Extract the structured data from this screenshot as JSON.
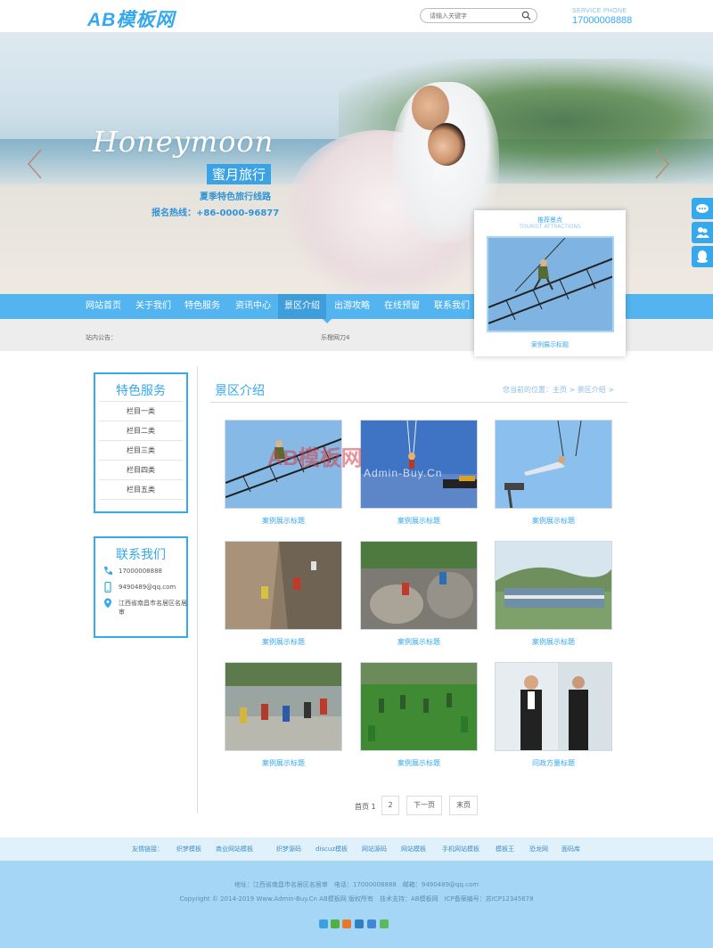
{
  "header": {
    "logo": "AB模板网",
    "search_placeholder": "请输入关键字",
    "phone_label": "SERVICE PHONE",
    "phone": "17000008888"
  },
  "banner": {
    "script": "Honeymoon",
    "title": "蜜月旅行",
    "subtitle": "夏季特色旅行线路",
    "hotline": "报名热线：+86-0000-96877"
  },
  "nav": {
    "items": [
      "网站首页",
      "关于我们",
      "特色服务",
      "资讯中心",
      "景区介绍",
      "出游攻略",
      "在线预留",
      "联系我们"
    ]
  },
  "notice": {
    "label": "站内公告：",
    "text": "乐橙网刀4"
  },
  "featured": {
    "title": "推荐景点",
    "subtitle": "TOURIST ATTRACTIONS",
    "caption": "案例展示标题"
  },
  "sidebar": {
    "services_title": "特色服务",
    "services": [
      "栏目一类",
      "栏目二类",
      "栏目三类",
      "栏目四类",
      "栏目五类"
    ],
    "contact_title": "联系我们",
    "contact": {
      "phone": "17000008888",
      "email": "9490489@qq.com",
      "address": "江西省南昌市名居区名居审"
    }
  },
  "main": {
    "title": "景区介绍",
    "breadcrumb": "您当前的位置：主页 > 景区介绍 >",
    "cases": [
      {
        "caption": "案例展示标题"
      },
      {
        "caption": "案例展示标题"
      },
      {
        "caption": "案例展示标题"
      },
      {
        "caption": "案例展示标题"
      },
      {
        "caption": "案例展示标题"
      },
      {
        "caption": "案例展示标题"
      },
      {
        "caption": "案例展示标题"
      },
      {
        "caption": "案例展示标题"
      },
      {
        "caption": "问政方量标题"
      }
    ],
    "watermark": "AB模板网",
    "watermark_sub": "Admin-Buy.Cn"
  },
  "pagination": {
    "label": "首页 1",
    "page": "2",
    "next": "下一页",
    "last": "末页"
  },
  "footer": {
    "friend_label": "友情链接：",
    "friend_links": [
      "织梦模板",
      "商业网站模板",
      "织梦源码",
      "discuz模板",
      "网站源码",
      "网站模板",
      "手机网站模板",
      "模板王",
      "恐龙网",
      "面码库"
    ],
    "address_line": "地址：江西省南昌市名居区名居审　电话：17000008888　邮箱：9490489@qq.com",
    "copyright_line": "Copyright © 2014-2019 Www.Admin-Buy.Cn AB模板网 版权所有　技术支持：AB模板网　ICP备案编号：苏ICP12345678"
  },
  "colors": {
    "accent": "#36a8ec",
    "nav": "#53b4ef",
    "footer": "#a6d6f5"
  }
}
